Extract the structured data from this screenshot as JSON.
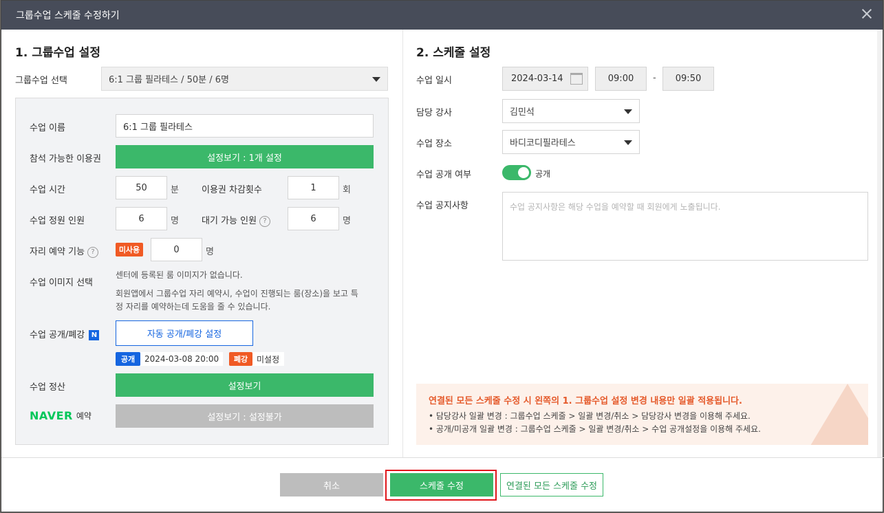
{
  "window": {
    "title": "그룹수업 스케줄 수정하기"
  },
  "left": {
    "section_title": "1. 그룹수업 설정",
    "group_select_label": "그룹수업 선택",
    "group_select_value": "6:1 그룹 필라테스 / 50분 / 6명",
    "class_name_label": "수업 이름",
    "class_name_value": "6:1 그룹 필라테스",
    "pass_label": "참석 가능한 이용권",
    "pass_button": "설정보기 : 1개 설정",
    "duration_label": "수업 시간",
    "duration_value": "50",
    "duration_unit": "분",
    "deduct_label": "이용권 차감횟수",
    "deduct_value": "1",
    "deduct_unit": "회",
    "capacity_label": "수업 정원 인원",
    "capacity_value": "6",
    "capacity_unit": "명",
    "waitlist_label": "대기 가능 인원",
    "waitlist_value": "6",
    "waitlist_unit": "명",
    "seat_label": "자리 예약 기능",
    "seat_tag": "미사용",
    "seat_value": "0",
    "seat_unit": "명",
    "help_glyph": "?",
    "image_label": "수업 이미지 선택",
    "image_text1": "센터에 등록된 룸 이미지가 없습니다.",
    "image_text2": "회원앱에서 그룹수업 자리 예약시, 수업이 진행되는 룸(장소)을 보고 특",
    "image_text3": "정 자리를 예약하는데 도움을 줄 수 있습니다.",
    "publish_label": "수업 공개/폐강",
    "new_badge": "N",
    "publish_button": "자동 공개/폐강 설정",
    "open_tag": "공개",
    "open_datetime": "2024-03-08 20:00",
    "close_tag": "폐강",
    "close_value": "미설정",
    "settle_label": "수업 정산",
    "settle_button": "설정보기",
    "naver_logo": "NAVER",
    "naver_suffix": "예약",
    "naver_button": "설정보기 : 설정불가"
  },
  "right": {
    "section_title": "2. 스케줄 설정",
    "date_label": "수업 일시",
    "date_value": "2024-03-14",
    "start_time": "09:00",
    "time_sep": "-",
    "end_time": "09:50",
    "instructor_label": "담당 강사",
    "instructor_value": "김민석",
    "place_label": "수업 장소",
    "place_value": "바디코디필라테스",
    "public_label": "수업 공개 여부",
    "public_state": "공개",
    "notice_label": "수업 공지사항",
    "notice_placeholder": "수업 공지사항은 해당 수업을 예약할 때 회원에게 노출됩니다."
  },
  "notice": {
    "headline": "연결된 모든 스케줄 수정 시 왼쪽의 1. 그룹수업 설정 변경 내용만 일괄 적용됩니다.",
    "line1": "•  담당강사 일괄 변경 : 그룹수업 스케줄 > 일괄 변경/취소 > 담당강사 변경을 이용해 주세요.",
    "line2": "•  공개/미공개 일괄 변경 : 그룹수업 스케줄 > 일괄 변경/취소 > 수업 공개설정을 이용해 주세요."
  },
  "footer": {
    "cancel": "취소",
    "save": "스케줄 수정",
    "save_all": "연결된 모든 스케줄 수정"
  },
  "colors": {
    "accent_green": "#3bb86a",
    "title_bar": "#474c59",
    "tag_blue": "#1565e0",
    "tag_orange": "#f05a24",
    "naver_green": "#03c75a",
    "highlight_red": "#e0161b"
  }
}
